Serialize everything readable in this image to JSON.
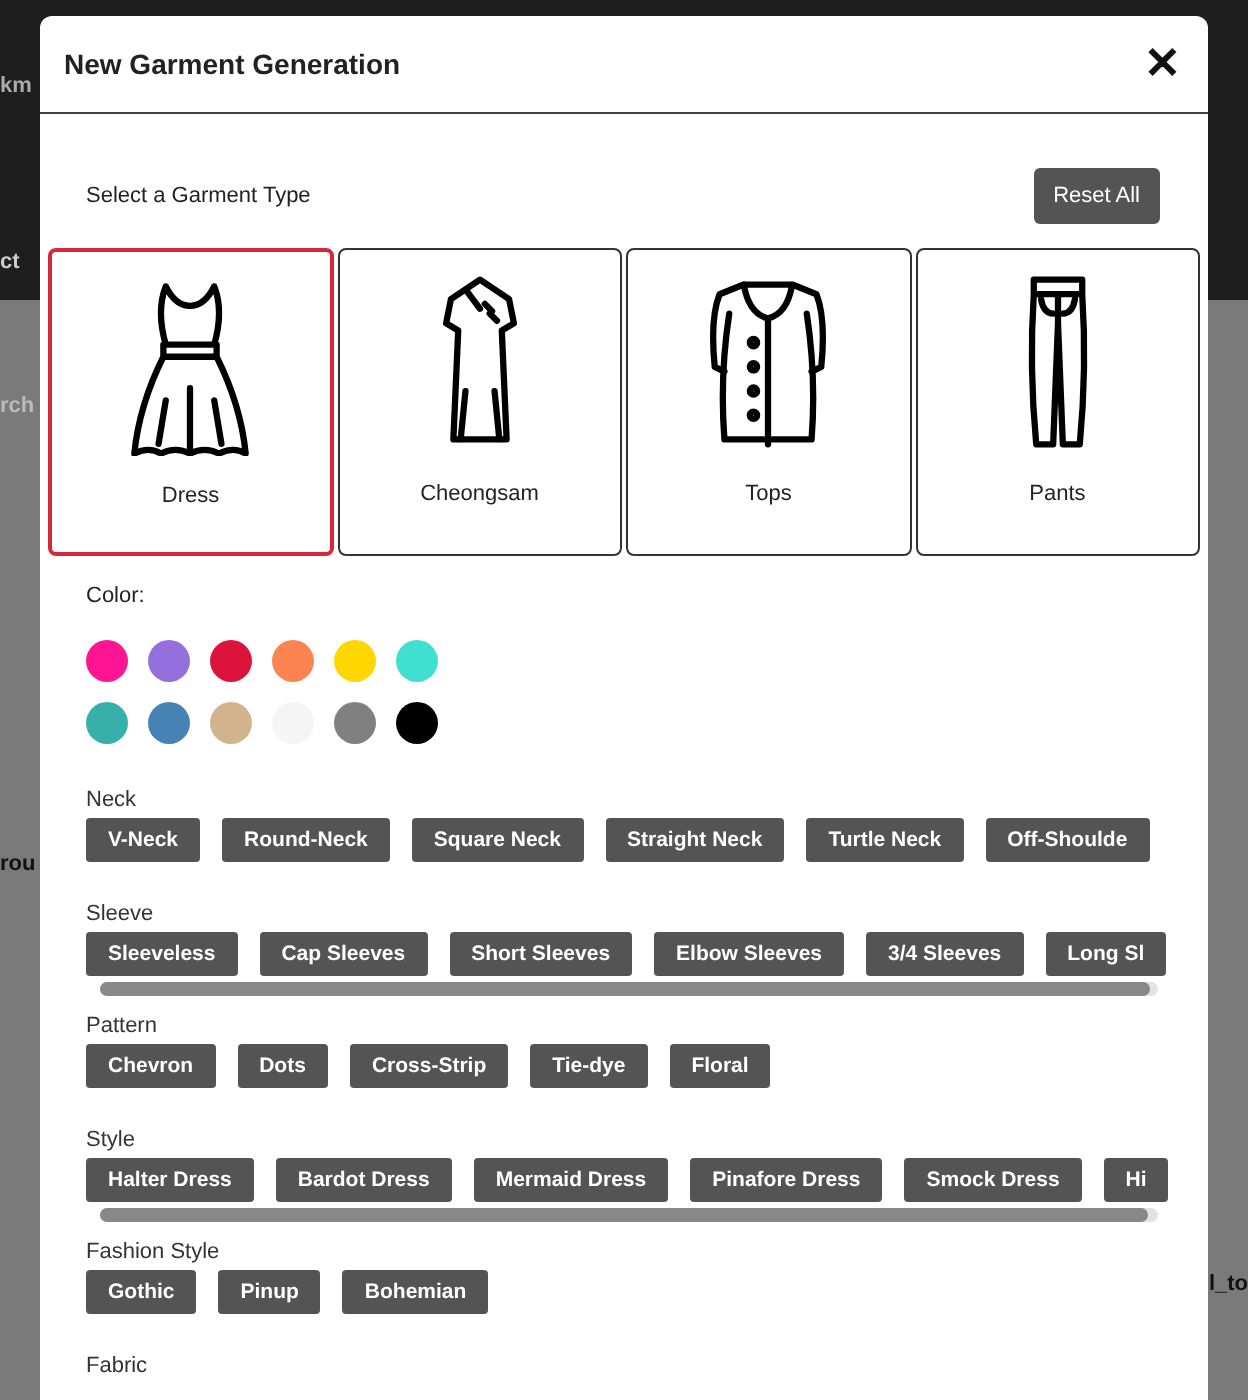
{
  "background": {
    "fragments": [
      {
        "text": "km"
      },
      {
        "text": "ct"
      },
      {
        "text": "rch"
      },
      {
        "text": "rou"
      },
      {
        "text": "l_to"
      }
    ]
  },
  "dialog": {
    "title": "New Garment Generation",
    "close": "✕"
  },
  "garment_type": {
    "label": "Select a Garment Type",
    "reset": "Reset All",
    "types": [
      {
        "kind": "dress",
        "label": "Dress",
        "selected": true
      },
      {
        "kind": "cheongsam",
        "label": "Cheongsam",
        "selected": false
      },
      {
        "kind": "top",
        "label": "Tops",
        "selected": false
      },
      {
        "kind": "pants",
        "label": "Pants",
        "selected": false
      }
    ]
  },
  "color": {
    "label": "Color:",
    "swatches": [
      {
        "color": "#ff1493"
      },
      {
        "color": "#9370db"
      },
      {
        "color": "#dc143c"
      },
      {
        "color": "#fb8550"
      },
      {
        "color": "#ffd700"
      },
      {
        "color": "#40e0d0"
      },
      {
        "color": "#36b0a8"
      },
      {
        "color": "#4682b4"
      },
      {
        "color": "#d2b48c"
      },
      {
        "color": "#f5f5f5"
      },
      {
        "color": "#808080"
      },
      {
        "color": "#000000"
      }
    ]
  },
  "options": [
    {
      "label": "Neck",
      "chips": [
        "V-Neck",
        "Round-Neck",
        "Square Neck",
        "Straight Neck",
        "Turtle Neck",
        "Off-Shoulde"
      ]
    },
    {
      "label": "Sleeve",
      "chips": [
        "Sleeveless",
        "Cap Sleeves",
        "Short Sleeves",
        "Elbow Sleeves",
        "3/4 Sleeves",
        "Long Sl"
      ]
    },
    {
      "label": "Pattern",
      "chips": [
        "Chevron",
        "Dots",
        "Cross-Strip",
        "Tie-dye",
        "Floral"
      ]
    },
    {
      "label": "Style",
      "chips": [
        "Halter Dress",
        "Bardot Dress",
        "Mermaid Dress",
        "Pinafore Dress",
        "Smock Dress",
        "Hi"
      ]
    },
    {
      "label": "Fashion Style",
      "chips": [
        "Gothic",
        "Pinup",
        "Bohemian"
      ]
    },
    {
      "label": "Fabric"
    }
  ]
}
